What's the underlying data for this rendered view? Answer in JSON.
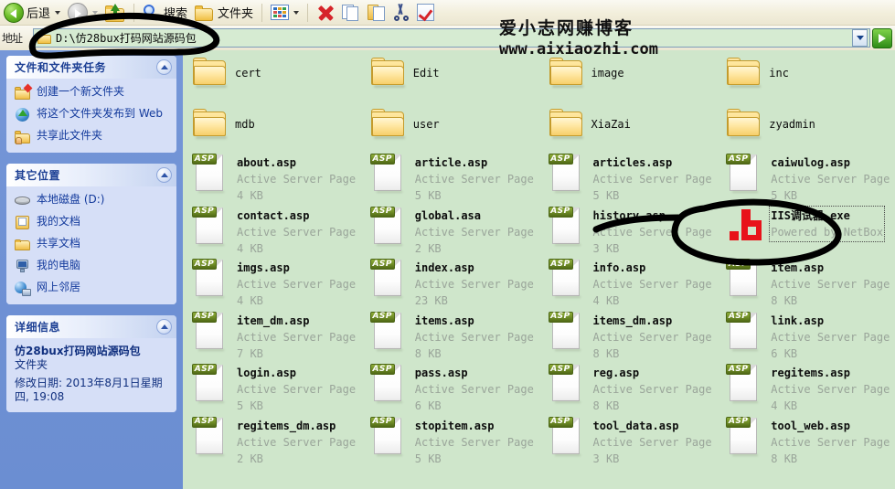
{
  "toolbar": {
    "back_label": "后退",
    "search_label": "搜索",
    "folders_label": "文件夹",
    "icons": [
      "back-icon",
      "forward-icon",
      "up-folder-icon",
      "search-icon",
      "folders-icon",
      "views-icon",
      "delete-icon",
      "copy-icon",
      "paste-icon",
      "cut-icon",
      "undo-icon"
    ]
  },
  "address": {
    "label": "地址",
    "value": "D:\\仿28bux打码网站源码包",
    "dropdown_icon": "chevron-down-icon",
    "go_icon": "go-arrow-icon"
  },
  "watermark": {
    "cn": "爱小志网赚博客",
    "url": "www.aixiaozhi.com"
  },
  "sidebar": {
    "panels": [
      {
        "title": "文件和文件夹任务",
        "items": [
          {
            "icon": "new-folder-icon",
            "label": "创建一个新文件夹"
          },
          {
            "icon": "publish-web-icon",
            "label": "将这个文件夹发布到 Web"
          },
          {
            "icon": "share-folder-icon",
            "label": "共享此文件夹"
          }
        ]
      },
      {
        "title": "其它位置",
        "items": [
          {
            "icon": "local-disk-icon",
            "label": "本地磁盘 (D:)"
          },
          {
            "icon": "my-documents-icon",
            "label": "我的文档"
          },
          {
            "icon": "shared-documents-icon",
            "label": "共享文档"
          },
          {
            "icon": "my-computer-icon",
            "label": "我的电脑"
          },
          {
            "icon": "network-places-icon",
            "label": "网上邻居"
          }
        ]
      },
      {
        "title": "详细信息",
        "details": {
          "name": "仿28bux打码网站源码包",
          "kind": "文件夹",
          "modified": "修改日期: 2013年8月1日星期四, 19:08"
        }
      }
    ]
  },
  "files": {
    "folders": [
      {
        "name": "cert"
      },
      {
        "name": "Edit"
      },
      {
        "name": "image"
      },
      {
        "name": "inc"
      },
      {
        "name": "mdb"
      },
      {
        "name": "user"
      },
      {
        "name": "XiaZai"
      },
      {
        "name": "zyadmin"
      }
    ],
    "documents": [
      {
        "name": "about.asp",
        "type": "Active Server Page",
        "size": "4 KB",
        "kind": "asp"
      },
      {
        "name": "article.asp",
        "type": "Active Server Page",
        "size": "5 KB",
        "kind": "asp"
      },
      {
        "name": "articles.asp",
        "type": "Active Server Page",
        "size": "5 KB",
        "kind": "asp"
      },
      {
        "name": "caiwulog.asp",
        "type": "Active Server Page",
        "size": "5 KB",
        "kind": "asp"
      },
      {
        "name": "contact.asp",
        "type": "Active Server Page",
        "size": "4 KB",
        "kind": "asp"
      },
      {
        "name": "global.asa",
        "type": "Active Server Page",
        "size": "2 KB",
        "kind": "asp"
      },
      {
        "name": "history.asp",
        "type": "Active Server Page",
        "size": "3 KB",
        "kind": "asp"
      },
      {
        "name": "IIS调试器.exe",
        "type": "Powered by NetBox",
        "size": "",
        "kind": "exe",
        "selected": true
      },
      {
        "name": "imgs.asp",
        "type": "Active Server Page",
        "size": "4 KB",
        "kind": "asp"
      },
      {
        "name": "index.asp",
        "type": "Active Server Page",
        "size": "23 KB",
        "kind": "asp"
      },
      {
        "name": "info.asp",
        "type": "Active Server Page",
        "size": "4 KB",
        "kind": "asp"
      },
      {
        "name": "item.asp",
        "type": "Active Server Page",
        "size": "8 KB",
        "kind": "asp"
      },
      {
        "name": "item_dm.asp",
        "type": "Active Server Page",
        "size": "7 KB",
        "kind": "asp"
      },
      {
        "name": "items.asp",
        "type": "Active Server Page",
        "size": "8 KB",
        "kind": "asp"
      },
      {
        "name": "items_dm.asp",
        "type": "Active Server Page",
        "size": "8 KB",
        "kind": "asp"
      },
      {
        "name": "link.asp",
        "type": "Active Server Page",
        "size": "6 KB",
        "kind": "asp"
      },
      {
        "name": "login.asp",
        "type": "Active Server Page",
        "size": "5 KB",
        "kind": "asp"
      },
      {
        "name": "pass.asp",
        "type": "Active Server Page",
        "size": "6 KB",
        "kind": "asp"
      },
      {
        "name": "reg.asp",
        "type": "Active Server Page",
        "size": "8 KB",
        "kind": "asp"
      },
      {
        "name": "regitems.asp",
        "type": "Active Server Page",
        "size": "4 KB",
        "kind": "asp"
      },
      {
        "name": "regitems_dm.asp",
        "type": "Active Server Page",
        "size": "2 KB",
        "kind": "asp"
      },
      {
        "name": "stopitem.asp",
        "type": "Active Server Page",
        "size": "5 KB",
        "kind": "asp"
      },
      {
        "name": "tool_data.asp",
        "type": "Active Server Page",
        "size": "3 KB",
        "kind": "asp"
      },
      {
        "name": "tool_web.asp",
        "type": "Active Server Page",
        "size": "8 KB",
        "kind": "asp"
      }
    ],
    "asp_badge_text": "ASP",
    "asp_glyph": "</>",
    "exe_glyph": ".b"
  },
  "colors": {
    "file_pane_bg": "#cfe6cb",
    "sidebar_bg": "#6f91d4",
    "panel_bg": "#d6dff7",
    "panel_title": "#1c3f94",
    "asp_badge": "#6d8a25",
    "exe_red": "#e8131a",
    "annotation": "#000000"
  },
  "annotations": {
    "address_circle": "hand-drawn-ellipse-around-address-bar",
    "file_circle": "hand-drawn-ellipse-around-iis-debugger-file"
  }
}
